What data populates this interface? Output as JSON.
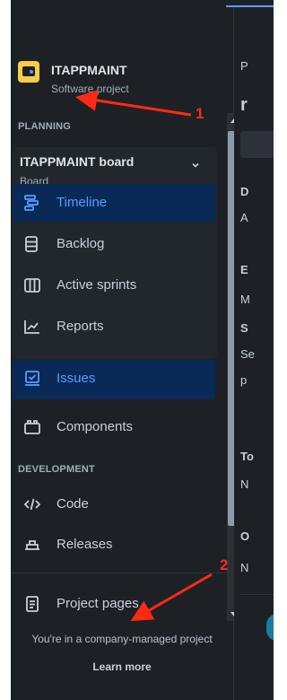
{
  "project": {
    "name": "ITAPPMAINT",
    "type": "Software project"
  },
  "sections": {
    "planning": "PLANNING",
    "development": "DEVELOPMENT"
  },
  "board": {
    "title": "ITAPPMAINT board",
    "subtitle": "Board"
  },
  "planning_items": [
    {
      "label": "Timeline",
      "icon": "timeline-icon",
      "active": true
    },
    {
      "label": "Backlog",
      "icon": "backlog-icon",
      "active": false
    },
    {
      "label": "Active sprints",
      "icon": "active-sprints-icon",
      "active": false
    },
    {
      "label": "Reports",
      "icon": "reports-icon",
      "active": false
    }
  ],
  "issues": {
    "label": "Issues",
    "icon": "issues-icon",
    "active": true
  },
  "components": {
    "label": "Components",
    "icon": "components-icon"
  },
  "development_items": [
    {
      "label": "Code",
      "icon": "code-icon"
    },
    {
      "label": "Releases",
      "icon": "releases-icon"
    }
  ],
  "project_pages": {
    "label": "Project pages",
    "icon": "page-icon"
  },
  "footer": {
    "text": "You're in a company-managed project",
    "link": "Learn more"
  },
  "content_fragments": [
    "P",
    "r",
    "D",
    "A",
    "E",
    "M",
    "S",
    "Se",
    "p",
    "To",
    "N",
    "O",
    "N"
  ],
  "annotations": [
    "1",
    "2"
  ],
  "colors": {
    "background": "#1d2125",
    "active_bg": "#092957",
    "active_text": "#579dff",
    "annotation": "#ff2a14",
    "project_avatar": "#f5cd47"
  }
}
